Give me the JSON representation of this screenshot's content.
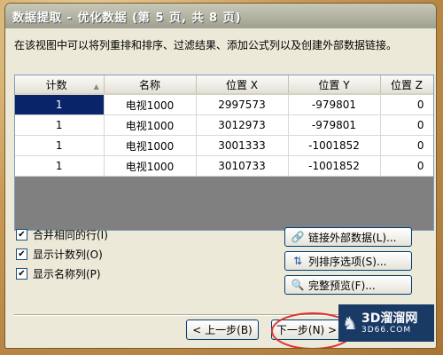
{
  "title": "数据提取 - 优化数据 (第 5 页, 共 8 页)",
  "description": "在该视图中可以将列重排和排序、过滤结果、添加公式列以及创建外部数据链接。",
  "table": {
    "headers": [
      "计数",
      "名称",
      "位置 X",
      "位置 Y",
      "位置 Z"
    ],
    "rows": [
      [
        "1",
        "电视1000",
        "2997573",
        "-979801",
        "0"
      ],
      [
        "1",
        "电视1000",
        "3012973",
        "-979801",
        "0"
      ],
      [
        "1",
        "电视1000",
        "3001333",
        "-1001852",
        "0"
      ],
      [
        "1",
        "电视1000",
        "3010733",
        "-1001852",
        "0"
      ]
    ]
  },
  "checkboxes": [
    {
      "label": "合并相同的行(I)",
      "checked": true
    },
    {
      "label": "显示计数列(O)",
      "checked": true
    },
    {
      "label": "显示名称列(P)",
      "checked": true
    }
  ],
  "buttons": {
    "link_external": "链接外部数据(L)...",
    "column_sort": "列排序选项(S)...",
    "full_preview": "完整预览(F)...",
    "back": "< 上一步(B)",
    "next": "下一步(N) >"
  },
  "watermark": {
    "line1": "3D溜溜网",
    "line2": "3D66.COM"
  },
  "colors": {
    "selection": "#0a246a",
    "highlight_circle": "#e03030"
  }
}
